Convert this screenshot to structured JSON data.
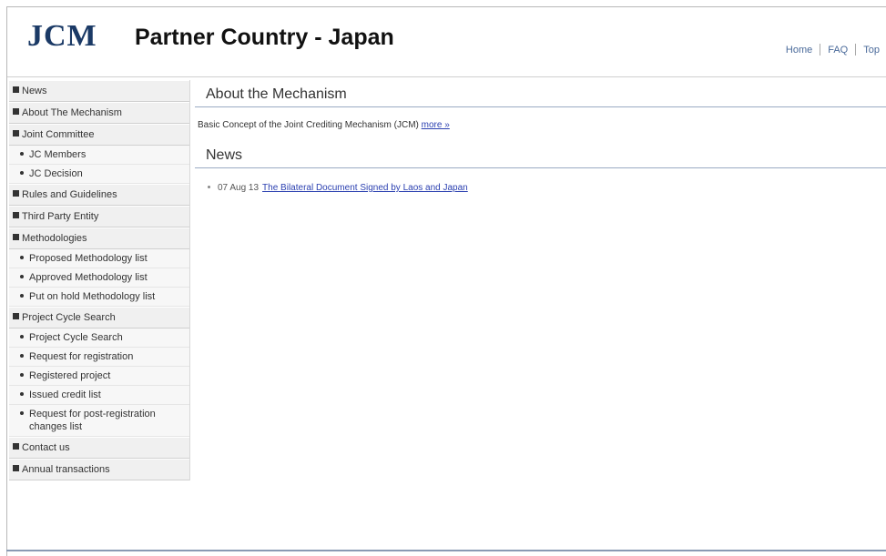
{
  "header": {
    "logo": "JCM",
    "title": "Partner Country - Japan",
    "nav": [
      "Home",
      "FAQ",
      "Top"
    ]
  },
  "sidebar": {
    "items": [
      {
        "label": "News"
      },
      {
        "label": "About The Mechanism"
      },
      {
        "label": "Joint Committee",
        "children": [
          "JC Members",
          "JC Decision"
        ]
      },
      {
        "label": "Rules and Guidelines"
      },
      {
        "label": "Third Party Entity"
      },
      {
        "label": "Methodologies",
        "children": [
          "Proposed Methodology list",
          "Approved Methodology list",
          "Put on hold Methodology list"
        ]
      },
      {
        "label": "Project Cycle Search",
        "children": [
          "Project Cycle Search",
          "Request for registration",
          "Registered project",
          "Issued credit list",
          "Request for post-registration changes list"
        ]
      },
      {
        "label": "Contact us"
      },
      {
        "label": "Annual transactions"
      }
    ]
  },
  "main": {
    "about_heading": "About the Mechanism",
    "about_text": "Basic Concept of the Joint Crediting Mechanism (JCM)",
    "more_link": "more »",
    "news_heading": "News",
    "news": [
      {
        "date": "07 Aug 13",
        "title": "The Bilateral Document Signed by Laos and Japan"
      }
    ]
  }
}
